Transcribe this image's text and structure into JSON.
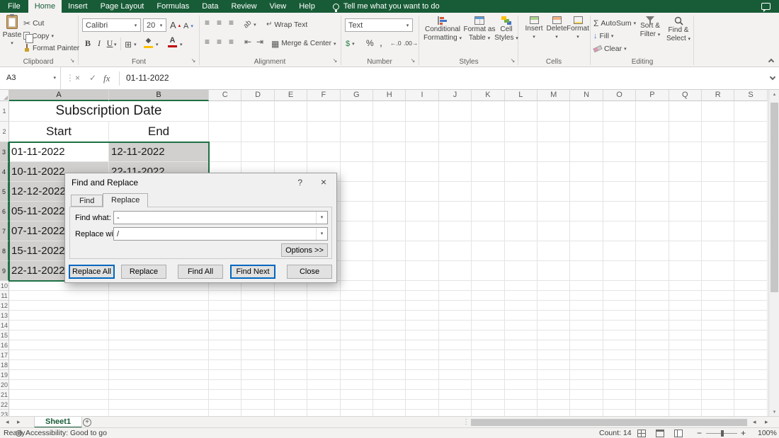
{
  "ribbon_tabs": {
    "file": "File",
    "items": [
      "Home",
      "Insert",
      "Page Layout",
      "Formulas",
      "Data",
      "Review",
      "View",
      "Help"
    ],
    "active": "Home",
    "tell_me": "Tell me what you want to do"
  },
  "ribbon": {
    "clipboard": {
      "label": "Clipboard",
      "paste": "Paste",
      "cut": "Cut",
      "copy": "Copy",
      "format_painter": "Format Painter"
    },
    "font": {
      "label": "Font",
      "name": "Calibri",
      "size": "20",
      "bold": "B",
      "italic": "I",
      "underline": "U"
    },
    "alignment": {
      "label": "Alignment",
      "wrap": "Wrap Text",
      "merge": "Merge & Center"
    },
    "number": {
      "label": "Number",
      "format": "Text",
      "accounting": "$",
      "percent": "%",
      "comma": ",",
      "dec_inc": "←.0",
      "dec_dec": ".00→"
    },
    "styles": {
      "label": "Styles",
      "conditional1": "Conditional",
      "conditional2": "Formatting",
      "table1": "Format as",
      "table2": "Table",
      "cells1": "Cell",
      "cells2": "Styles"
    },
    "cells": {
      "label": "Cells",
      "insert": "Insert",
      "delete": "Delete",
      "format": "Format"
    },
    "editing": {
      "label": "Editing",
      "autosum": "AutoSum",
      "fill": "Fill",
      "clear": "Clear",
      "sort1": "Sort &",
      "sort2": "Filter",
      "find1": "Find &",
      "find2": "Select"
    }
  },
  "formula_bar": {
    "name_box": "A3",
    "fx": "fx",
    "value": "01-11-2022"
  },
  "grid": {
    "col_headers": [
      "A",
      "B",
      "C",
      "D",
      "E",
      "F",
      "G",
      "H",
      "I",
      "J",
      "K",
      "L",
      "M",
      "N",
      "O",
      "P",
      "Q",
      "R",
      "S"
    ],
    "row_count": 23,
    "title": "Subscription Date",
    "header_start": "Start",
    "header_end": "End",
    "data_rows": [
      {
        "start": "01-11-2022",
        "end": "12-11-2022"
      },
      {
        "start": "10-11-2022",
        "end": "22-11-2022"
      },
      {
        "start": "12-12-2022",
        "end": ""
      },
      {
        "start": "05-11-2022",
        "end": ""
      },
      {
        "start": "07-11-2022",
        "end": ""
      },
      {
        "start": "15-11-2022",
        "end": ""
      },
      {
        "start": "22-11-2022",
        "end": ""
      }
    ]
  },
  "dialog": {
    "title": "Find and Replace",
    "help": "?",
    "close_x": "×",
    "tab_find": "Find",
    "tab_replace": "Replace",
    "find_label": "Find what:",
    "find_value": "-",
    "replace_label": "Replace with:",
    "replace_value": "/",
    "options": "Options >>",
    "replace_all": "Replace All",
    "replace": "Replace",
    "find_all": "Find All",
    "find_next": "Find Next",
    "close": "Close"
  },
  "sheet_tabs": {
    "active": "Sheet1"
  },
  "status_bar": {
    "ready": "Ready",
    "accessibility": "Accessibility: Good to go",
    "count": "Count: 14",
    "zoom": "100%"
  }
}
